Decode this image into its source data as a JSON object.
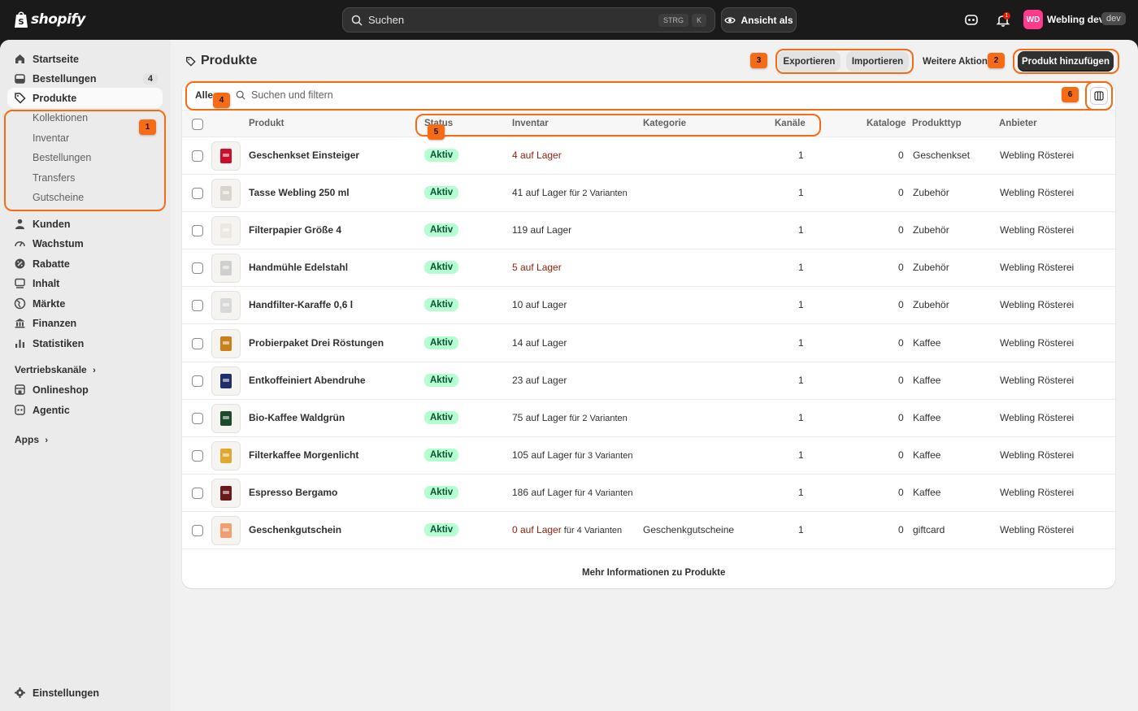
{
  "topbar": {
    "brand": "shopify",
    "search_placeholder": "Suchen",
    "shortcut_keys": [
      "STRG",
      "K"
    ],
    "view_as_label": "Ansicht als",
    "notification_count": "1",
    "avatar_initials": "WD",
    "store_name": "Webling dev",
    "store_badge": "dev"
  },
  "sidebar": {
    "items": [
      {
        "label": "Startseite",
        "icon": "home-icon"
      },
      {
        "label": "Bestellungen",
        "icon": "orders-icon",
        "count": "4"
      },
      {
        "label": "Produkte",
        "icon": "tag-icon"
      }
    ],
    "product_subitems": [
      "Kollektionen",
      "Inventar",
      "Bestellungen",
      "Transfers",
      "Gutscheine"
    ],
    "items_after": [
      {
        "label": "Kunden",
        "icon": "person-icon"
      },
      {
        "label": "Wachstum",
        "icon": "gauge-icon"
      },
      {
        "label": "Rabatte",
        "icon": "discount-icon"
      },
      {
        "label": "Inhalt",
        "icon": "content-icon"
      },
      {
        "label": "Märkte",
        "icon": "globe-icon"
      },
      {
        "label": "Finanzen",
        "icon": "bank-icon"
      },
      {
        "label": "Statistiken",
        "icon": "chart-icon"
      }
    ],
    "sales_channels_label": "Vertriebskanäle",
    "channels": [
      {
        "label": "Onlineshop",
        "icon": "store-icon"
      },
      {
        "label": "Agentic",
        "icon": "agentic-icon"
      }
    ],
    "apps_label": "Apps",
    "settings_label": "Einstellungen"
  },
  "page": {
    "title": "Produkte",
    "export_label": "Exportieren",
    "import_label": "Importieren",
    "more_actions_label": "Weitere Aktionen",
    "add_product_label": "Produkt hinzufügen",
    "tab_all": "Alle",
    "filter_placeholder": "Suchen und filtern",
    "footer_link": "Mehr Informationen zu Produkte"
  },
  "table": {
    "headers": {
      "product": "Produkt",
      "status": "Status",
      "inventory": "Inventar",
      "category": "Kategorie",
      "channels": "Kanäle",
      "catalogs": "Kataloge",
      "product_type": "Produkttyp",
      "vendor": "Anbieter"
    },
    "rows": [
      {
        "name": "Geschenkset Einsteiger",
        "status": "Aktiv",
        "inv": "4 auf Lager",
        "inv_variants": "",
        "low": true,
        "category": "",
        "channels": "1",
        "catalogs": "0",
        "type": "Geschenkset",
        "vendor": "Webling Rösterei",
        "thumb_color": "#c8102e"
      },
      {
        "name": "Tasse Webling 250 ml",
        "status": "Aktiv",
        "inv": "41 auf Lager",
        "inv_variants": " für 2 Varianten",
        "low": false,
        "category": "",
        "channels": "1",
        "catalogs": "0",
        "type": "Zubehör",
        "vendor": "Webling Rösterei",
        "thumb_color": "#d9d4cc"
      },
      {
        "name": "Filterpapier Größe 4",
        "status": "Aktiv",
        "inv": "119 auf Lager",
        "inv_variants": "",
        "low": false,
        "category": "",
        "channels": "1",
        "catalogs": "0",
        "type": "Zubehör",
        "vendor": "Webling Rösterei",
        "thumb_color": "#ece7df"
      },
      {
        "name": "Handmühle Edelstahl",
        "status": "Aktiv",
        "inv": "5 auf Lager",
        "inv_variants": "",
        "low": true,
        "category": "",
        "channels": "1",
        "catalogs": "0",
        "type": "Zubehör",
        "vendor": "Webling Rösterei",
        "thumb_color": "#cfcfcf"
      },
      {
        "name": "Handfilter-Karaffe 0,6 l",
        "status": "Aktiv",
        "inv": "10 auf Lager",
        "inv_variants": "",
        "low": false,
        "category": "",
        "channels": "1",
        "catalogs": "0",
        "type": "Zubehör",
        "vendor": "Webling Rösterei",
        "thumb_color": "#d8d8d8"
      },
      {
        "name": "Probierpaket Drei Röstungen",
        "status": "Aktiv",
        "inv": "14 auf Lager",
        "inv_variants": "",
        "low": false,
        "category": "",
        "channels": "1",
        "catalogs": "0",
        "type": "Kaffee",
        "vendor": "Webling Rösterei",
        "thumb_color": "#c9801b"
      },
      {
        "name": "Entkoffeiniert Abendruhe",
        "status": "Aktiv",
        "inv": "23 auf Lager",
        "inv_variants": "",
        "low": false,
        "category": "",
        "channels": "1",
        "catalogs": "0",
        "type": "Kaffee",
        "vendor": "Webling Rösterei",
        "thumb_color": "#1f2f6b"
      },
      {
        "name": "Bio-Kaffee Waldgrün",
        "status": "Aktiv",
        "inv": "75 auf Lager",
        "inv_variants": " für 2 Varianten",
        "low": false,
        "category": "",
        "channels": "1",
        "catalogs": "0",
        "type": "Kaffee",
        "vendor": "Webling Rösterei",
        "thumb_color": "#1d4a2b"
      },
      {
        "name": "Filterkaffee Morgenlicht",
        "status": "Aktiv",
        "inv": "105 auf Lager",
        "inv_variants": " für 3 Varianten",
        "low": false,
        "category": "",
        "channels": "1",
        "catalogs": "0",
        "type": "Kaffee",
        "vendor": "Webling Rösterei",
        "thumb_color": "#e0a82e"
      },
      {
        "name": "Espresso Bergamo",
        "status": "Aktiv",
        "inv": "186 auf Lager",
        "inv_variants": " für 4 Varianten",
        "low": false,
        "category": "",
        "channels": "1",
        "catalogs": "0",
        "type": "Kaffee",
        "vendor": "Webling Rösterei",
        "thumb_color": "#6b1a1a"
      },
      {
        "name": "Geschenkgutschein",
        "status": "Aktiv",
        "inv": "0 auf Lager",
        "inv_variants": " für 4 Varianten",
        "low": true,
        "category": "Geschenkgutscheine",
        "channels": "1",
        "catalogs": "0",
        "type": "giftcard",
        "vendor": "Webling Rösterei",
        "thumb_color": "#f0a070"
      }
    ]
  },
  "annotations": [
    "1",
    "2",
    "3",
    "4",
    "5",
    "6"
  ],
  "colors": {
    "accent": "#f76b15",
    "active_badge": "#b4fed2",
    "low_stock": "#8e1f0b",
    "primary_button": "#303030"
  }
}
